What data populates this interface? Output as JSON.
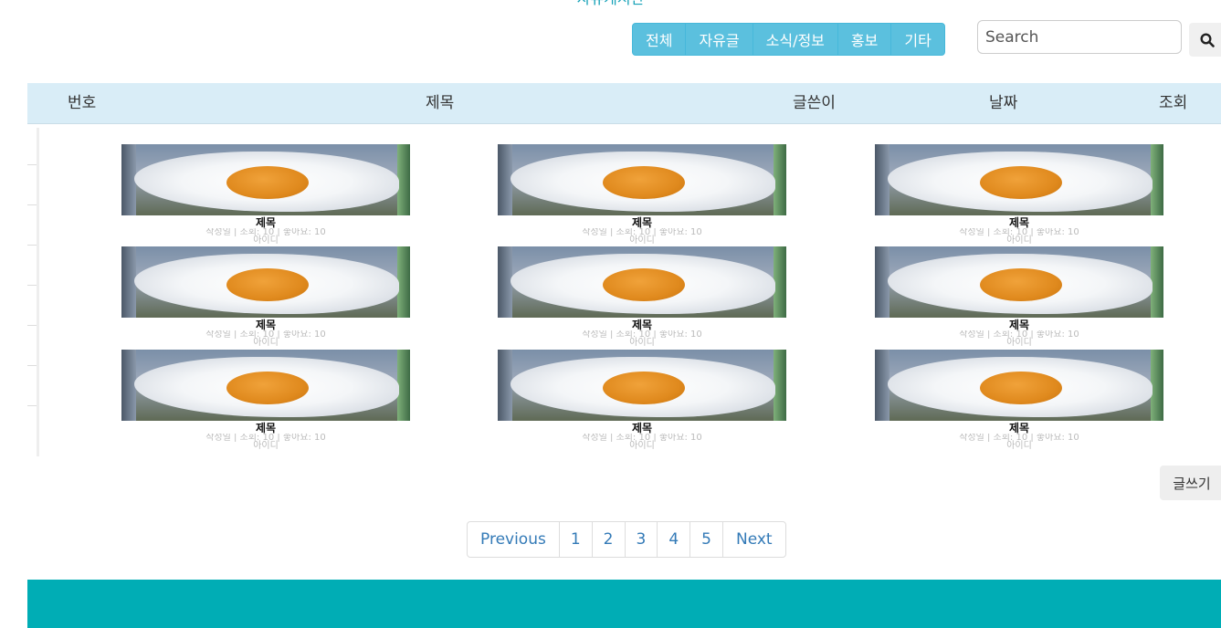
{
  "header": {
    "title": "자유게시판"
  },
  "categories": [
    "전체",
    "자유글",
    "소식/정보",
    "홍보",
    "기타"
  ],
  "search": {
    "placeholder": "Search"
  },
  "table": {
    "columns": [
      "번호",
      "제목",
      "글쓴이",
      "날짜",
      "조회"
    ]
  },
  "cards": [
    {
      "title": "제목",
      "meta": "작성일 | 조회: 10 | 좋아요: 10",
      "author": "아이디"
    },
    {
      "title": "제목",
      "meta": "작성일 | 조회: 10 | 좋아요: 10",
      "author": "아이디"
    },
    {
      "title": "제목",
      "meta": "작성일 | 조회: 10 | 좋아요: 10",
      "author": "아이디"
    },
    {
      "title": "제목",
      "meta": "작성일 | 조회: 10 | 좋아요: 10",
      "author": "아이디"
    },
    {
      "title": "제목",
      "meta": "작성일 | 조회: 10 | 좋아요: 10",
      "author": "아이디"
    },
    {
      "title": "제목",
      "meta": "작성일 | 조회: 10 | 좋아요: 10",
      "author": "아이디"
    },
    {
      "title": "제목",
      "meta": "작성일 | 조회: 10 | 좋아요: 10",
      "author": "아이디"
    },
    {
      "title": "제목",
      "meta": "작성일 | 조회: 10 | 좋아요: 10",
      "author": "아이디"
    },
    {
      "title": "제목",
      "meta": "작성일 | 조회: 10 | 좋아요: 10",
      "author": "아이디"
    }
  ],
  "actions": {
    "write_label": "글쓰기"
  },
  "pagination": {
    "previous": "Previous",
    "pages": [
      "1",
      "2",
      "3",
      "4",
      "5"
    ],
    "next": "Next"
  },
  "icons": {
    "search": "search-icon"
  },
  "colors": {
    "accent": "#5bc0de",
    "table_header": "#d9edf7",
    "footer": "#00adb5",
    "link": "#337ab7"
  }
}
